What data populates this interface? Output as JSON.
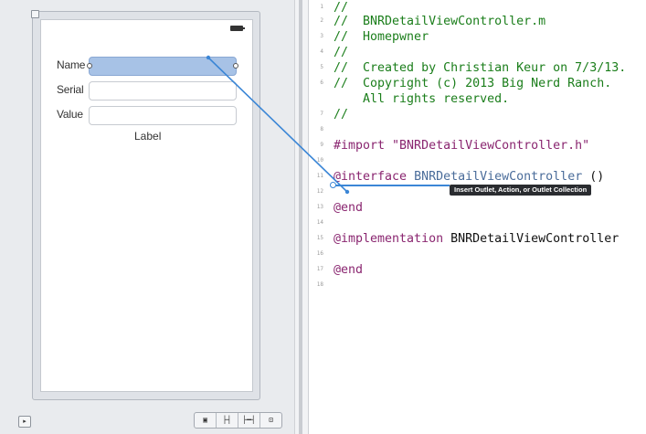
{
  "canvas": {
    "fields": [
      {
        "label": "Name",
        "value": ""
      },
      {
        "label": "Serial",
        "value": ""
      },
      {
        "label": "Value",
        "value": ""
      }
    ],
    "center_label": "Label"
  },
  "toolbar": {
    "buttons": [
      "▣",
      "├┤",
      "├━┤",
      "⊡"
    ]
  },
  "editor": {
    "lines": [
      {
        "n": "1",
        "text": "//"
      },
      {
        "n": "2",
        "text": "//  BNRDetailViewController.m"
      },
      {
        "n": "3",
        "text": "//  Homepwner"
      },
      {
        "n": "4",
        "text": "//"
      },
      {
        "n": "5",
        "text": "//  Created by Christian Keur on 7/3/13."
      },
      {
        "n": "6",
        "text": "//  Copyright (c) 2013 Big Nerd Ranch."
      },
      {
        "n": "",
        "text": "    All rights reserved."
      },
      {
        "n": "7",
        "text": "//"
      },
      {
        "n": "8",
        "text": ""
      },
      {
        "n": "9",
        "text": "#import \"BNRDetailViewController.h\""
      },
      {
        "n": "10",
        "text": ""
      },
      {
        "n": "11",
        "keyword": "@interface",
        "classname": "BNRDetailViewController",
        "rest": " ()"
      },
      {
        "n": "12",
        "text": ""
      },
      {
        "n": "13",
        "keyword": "@end"
      },
      {
        "n": "14",
        "text": ""
      },
      {
        "n": "15",
        "keyword": "@implementation",
        "rest": " BNRDetailViewController"
      },
      {
        "n": "16",
        "text": ""
      },
      {
        "n": "17",
        "keyword": "@end"
      },
      {
        "n": "18",
        "text": ""
      }
    ],
    "tooltip": "Insert Outlet, Action, or Outlet Collection"
  },
  "colors": {
    "comment": "#1b7e1b",
    "directive": "#8a2670",
    "string": "#b22222",
    "connection": "#3b86d6",
    "selected_field": "#a7c2e6"
  }
}
